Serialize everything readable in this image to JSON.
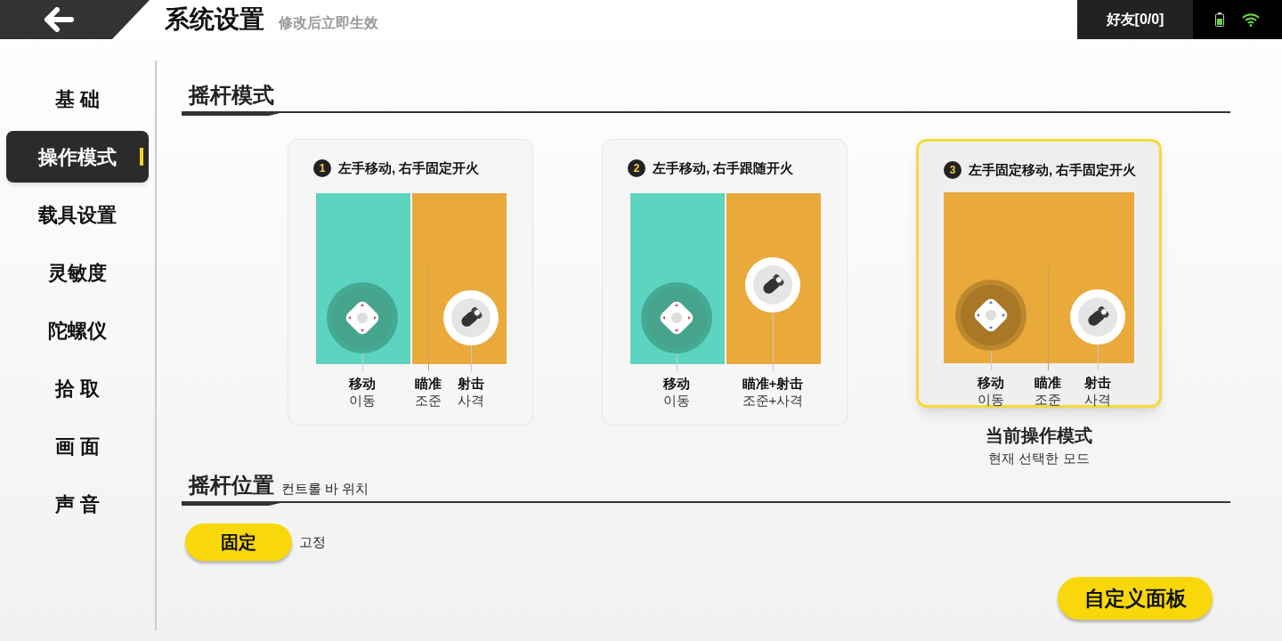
{
  "header": {
    "title": "系统设置",
    "subtitle": "修改后立即生效",
    "friends": "好友[0/0]"
  },
  "sidebar": {
    "items": [
      {
        "label": "基 础",
        "selected": false
      },
      {
        "label": "操作模式",
        "selected": true
      },
      {
        "label": "载具设置",
        "selected": false
      },
      {
        "label": "灵敏度",
        "selected": false
      },
      {
        "label": "陀螺仪",
        "selected": false
      },
      {
        "label": "拾 取",
        "selected": false
      },
      {
        "label": "画 面",
        "selected": false
      },
      {
        "label": "声 音",
        "selected": false
      }
    ]
  },
  "stick_mode": {
    "title": "摇杆模式",
    "modes": [
      {
        "number": "1",
        "title": "左手移动, 右手固定开火",
        "kind": "split",
        "selected": false,
        "labels": [
          {
            "title": "移动",
            "sub": "이동"
          },
          {
            "title": "瞄准",
            "sub": "조준"
          },
          {
            "title": "射击",
            "sub": "사격"
          }
        ]
      },
      {
        "number": "2",
        "title": "左手移动, 右手跟随开火",
        "kind": "follow",
        "selected": false,
        "labels": [
          {
            "title": "移动",
            "sub": "이동"
          },
          {
            "title": "瞄准+射击",
            "sub": "조준+사격"
          }
        ]
      },
      {
        "number": "3",
        "title": "左手固定移动, 右手固定开火",
        "kind": "full",
        "selected": true,
        "labels": [
          {
            "title": "移动",
            "sub": "이동"
          },
          {
            "title": "瞄准",
            "sub": "조준"
          },
          {
            "title": "射击",
            "sub": "사격"
          }
        ]
      }
    ],
    "current": {
      "title": "当前操作模式",
      "sub": "현재 선택한 모드"
    }
  },
  "stick_position": {
    "title": "摇杆位置",
    "subtitle": "컨트롤 바 위치",
    "button": "固定",
    "button_note": "고정"
  },
  "custom_panel_button": "自定义面板"
}
